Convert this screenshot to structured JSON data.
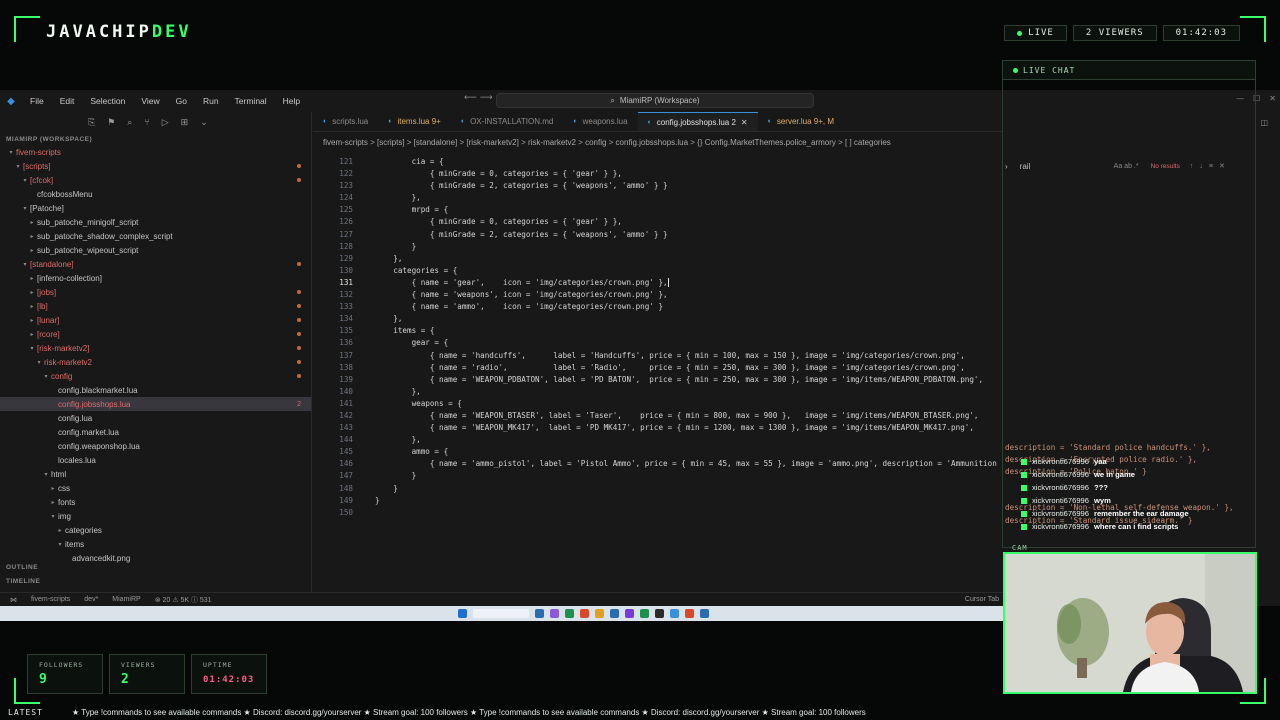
{
  "overlay": {
    "brand_main": "JAVACHIP",
    "brand_accent": "DEV",
    "live_label": "LIVE",
    "viewers_label": "2 VIEWERS",
    "clock": "01:42:03",
    "chat_title": "LIVE CHAT",
    "cam_label": "CAM",
    "latest_label": "LATEST",
    "ticker_text": "★ Type !commands to see available commands  ★ Discord: discord.gg/yourserver  ★ Stream goal: 100 followers  ★ Type !commands to see available commands  ★ Discord: discord.gg/yourserver  ★ Stream goal: 100 followers",
    "stats": [
      {
        "label": "FOLLOWERS",
        "value": "9"
      },
      {
        "label": "VIEWERS",
        "value": "2"
      },
      {
        "label": "UPTIME",
        "value": "01:42:03"
      }
    ],
    "accent_color": "#39ff6a"
  },
  "chat": {
    "messages": [
      {
        "user": "xickvronti676996",
        "text": "yaa"
      },
      {
        "user": "xickvronti676996",
        "text": "we in game"
      },
      {
        "user": "xickvronti676996",
        "text": "???"
      },
      {
        "user": "xickvronti676996",
        "text": "wym"
      },
      {
        "user": "xickvronti676996",
        "text": "remember the ear damage"
      },
      {
        "user": "xickvronti676996",
        "text": "where can i find scripts"
      }
    ]
  },
  "editor": {
    "menu": [
      "File",
      "Edit",
      "Selection",
      "View",
      "Go",
      "Run",
      "Terminal",
      "Help"
    ],
    "command_center": "MiamiRP (Workspace)",
    "workspace_header": "MIAMIRP (WORKSPACE)",
    "tree": [
      {
        "label": "fivem-scripts",
        "depth": 0,
        "chev": "v",
        "red": true
      },
      {
        "label": "[scripts]",
        "depth": 1,
        "chev": "v",
        "red": true,
        "dot": true
      },
      {
        "label": "[cfcok]",
        "depth": 2,
        "chev": "v",
        "red": true,
        "dot": true
      },
      {
        "label": "cfcokbossMenu",
        "depth": 3,
        "chev": "",
        "red": false
      },
      {
        "label": "[Patoche]",
        "depth": 2,
        "chev": "v",
        "red": false
      },
      {
        "label": "sub_patoche_minigolf_script",
        "depth": 3,
        "chev": ">",
        "red": false
      },
      {
        "label": "sub_patoche_shadow_complex_script",
        "depth": 3,
        "chev": ">",
        "red": false
      },
      {
        "label": "sub_patoche_wipeout_script",
        "depth": 3,
        "chev": ">",
        "red": false
      },
      {
        "label": "[standalone]",
        "depth": 2,
        "chev": "v",
        "red": true,
        "dot": true
      },
      {
        "label": "[inferno-collection]",
        "depth": 3,
        "chev": ">",
        "red": false
      },
      {
        "label": "[jobs]",
        "depth": 3,
        "chev": ">",
        "red": true,
        "dot": true
      },
      {
        "label": "[lb]",
        "depth": 3,
        "chev": ">",
        "red": true,
        "dot": true
      },
      {
        "label": "[lunar]",
        "depth": 3,
        "chev": ">",
        "red": true,
        "dot": true
      },
      {
        "label": "[rcore]",
        "depth": 3,
        "chev": ">",
        "red": true,
        "dot": true
      },
      {
        "label": "[risk-marketv2]",
        "depth": 3,
        "chev": "v",
        "red": true,
        "dot": true
      },
      {
        "label": "risk-marketv2",
        "depth": 4,
        "chev": "v",
        "red": true,
        "dot": true
      },
      {
        "label": "config",
        "depth": 5,
        "chev": "v",
        "red": true,
        "dot": true
      },
      {
        "label": "config.blackmarket.lua",
        "depth": 6,
        "chev": "",
        "red": false
      },
      {
        "label": "config.jobsshops.lua",
        "depth": 6,
        "chev": "",
        "red": true,
        "count": "2",
        "sel": true
      },
      {
        "label": "config.lua",
        "depth": 6,
        "chev": "",
        "red": false
      },
      {
        "label": "config.market.lua",
        "depth": 6,
        "chev": "",
        "red": false
      },
      {
        "label": "config.weaponshop.lua",
        "depth": 6,
        "chev": "",
        "red": false
      },
      {
        "label": "locales.lua",
        "depth": 6,
        "chev": "",
        "red": false
      },
      {
        "label": "html",
        "depth": 5,
        "chev": "v",
        "red": false
      },
      {
        "label": "css",
        "depth": 6,
        "chev": ">",
        "red": false
      },
      {
        "label": "fonts",
        "depth": 6,
        "chev": ">",
        "red": false
      },
      {
        "label": "img",
        "depth": 6,
        "chev": "v",
        "red": false
      },
      {
        "label": "categories",
        "depth": 7,
        "chev": ">",
        "red": false
      },
      {
        "label": "items",
        "depth": 7,
        "chev": "v",
        "red": false
      },
      {
        "label": "advancedkit.png",
        "depth": 8,
        "chev": "",
        "red": false
      }
    ],
    "outline_label": "OUTLINE",
    "timeline_label": "TIMELINE",
    "tabs": [
      {
        "label": "scripts.lua",
        "state": ""
      },
      {
        "label": "items.lua 9+",
        "state": "mod"
      },
      {
        "label": "OX-INSTALLATION.md",
        "state": ""
      },
      {
        "label": "weapons.lua",
        "state": ""
      },
      {
        "label": "config.jobsshops.lua 2",
        "state": "active"
      },
      {
        "label": "server.lua 9+, M",
        "state": "mod"
      }
    ],
    "breadcrumbs": "fivem-scripts  >  [scripts]  >  [standalone]  >  [risk-marketv2]  >  risk-marketv2  >  config  >  config.jobsshops.lua  >  {} Config.MarketThemes.police_armory  >  [ ] categories",
    "find_query": "rail",
    "find_opts": "Aa  ab  .*",
    "find_result": "No results",
    "code_lines": [
      {
        "n": "121",
        "t": "        cia = {"
      },
      {
        "n": "122",
        "t": "            { minGrade = 0, categories = { 'gear' } },"
      },
      {
        "n": "123",
        "t": "            { minGrade = 2, categories = { 'weapons', 'ammo' } }"
      },
      {
        "n": "124",
        "t": "        },"
      },
      {
        "n": "125",
        "t": "        mrpd = {"
      },
      {
        "n": "126",
        "t": "            { minGrade = 0, categories = { 'gear' } },"
      },
      {
        "n": "127",
        "t": "            { minGrade = 2, categories = { 'weapons', 'ammo' } }"
      },
      {
        "n": "128",
        "t": "        }"
      },
      {
        "n": "129",
        "t": "    },"
      },
      {
        "n": "130",
        "t": "    categories = {"
      },
      {
        "n": "131",
        "t": "        { name = 'gear',    icon = 'img/categories/crown.png' },",
        "cur": true
      },
      {
        "n": "132",
        "t": "        { name = 'weapons', icon = 'img/categories/crown.png' },"
      },
      {
        "n": "133",
        "t": "        { name = 'ammo',    icon = 'img/categories/crown.png' }"
      },
      {
        "n": "134",
        "t": "    },"
      },
      {
        "n": "135",
        "t": "    items = {"
      },
      {
        "n": "136",
        "t": "        gear = {"
      },
      {
        "n": "137",
        "t": "            { name = 'handcuffs',      label = 'Handcuffs', price = { min = 100, max = 150 }, image = 'img/categories/crown.png',"
      },
      {
        "n": "138",
        "t": "            { name = 'radio',          label = 'Radio',     price = { min = 250, max = 300 }, image = 'img/categories/crown.png',"
      },
      {
        "n": "139",
        "t": "            { name = 'WEAPON_PDBATON', label = 'PD BATON',  price = { min = 250, max = 300 }, image = 'img/items/WEAPON_PDBATON.png',"
      },
      {
        "n": "140",
        "t": "        },"
      },
      {
        "n": "141",
        "t": "        weapons = {"
      },
      {
        "n": "142",
        "t": "            { name = 'WEAPON_BTASER', label = 'Taser',    price = { min = 800, max = 900 },   image = 'img/items/WEAPON_BTASER.png',"
      },
      {
        "n": "143",
        "t": "            { name = 'WEAPON_MK417',  label = 'PD MK417', price = { min = 1200, max = 1300 }, image = 'img/items/WEAPON_MK417.png',"
      },
      {
        "n": "144",
        "t": "        },"
      },
      {
        "n": "145",
        "t": "        ammo = {"
      },
      {
        "n": "146",
        "t": "            { name = 'ammo_pistol', label = 'Pistol Ammo', price = { min = 45, max = 55 }, image = 'ammo.png', description = 'Ammunition"
      },
      {
        "n": "147",
        "t": "        }"
      },
      {
        "n": "148",
        "t": "    }"
      },
      {
        "n": "149",
        "t": "}"
      },
      {
        "n": "150",
        "t": ""
      }
    ],
    "overflow_lines": [
      "description = 'Standard police handcuffs.' },",
      "description = 'Encrypted police radio.' },",
      "description = 'Police baton.' }",
      "",
      "",
      "description = 'Non-lethal self-defense weapon.' },",
      "description = 'Standard issue sidearm.' }"
    ],
    "status": {
      "branch": "fivem-scripts",
      "git": "dev*",
      "workspace": "MiamiRP",
      "problems": "⊗ 20  ⚠ 5K  ⓘ 531",
      "cursor": "Cursor Tab"
    }
  }
}
